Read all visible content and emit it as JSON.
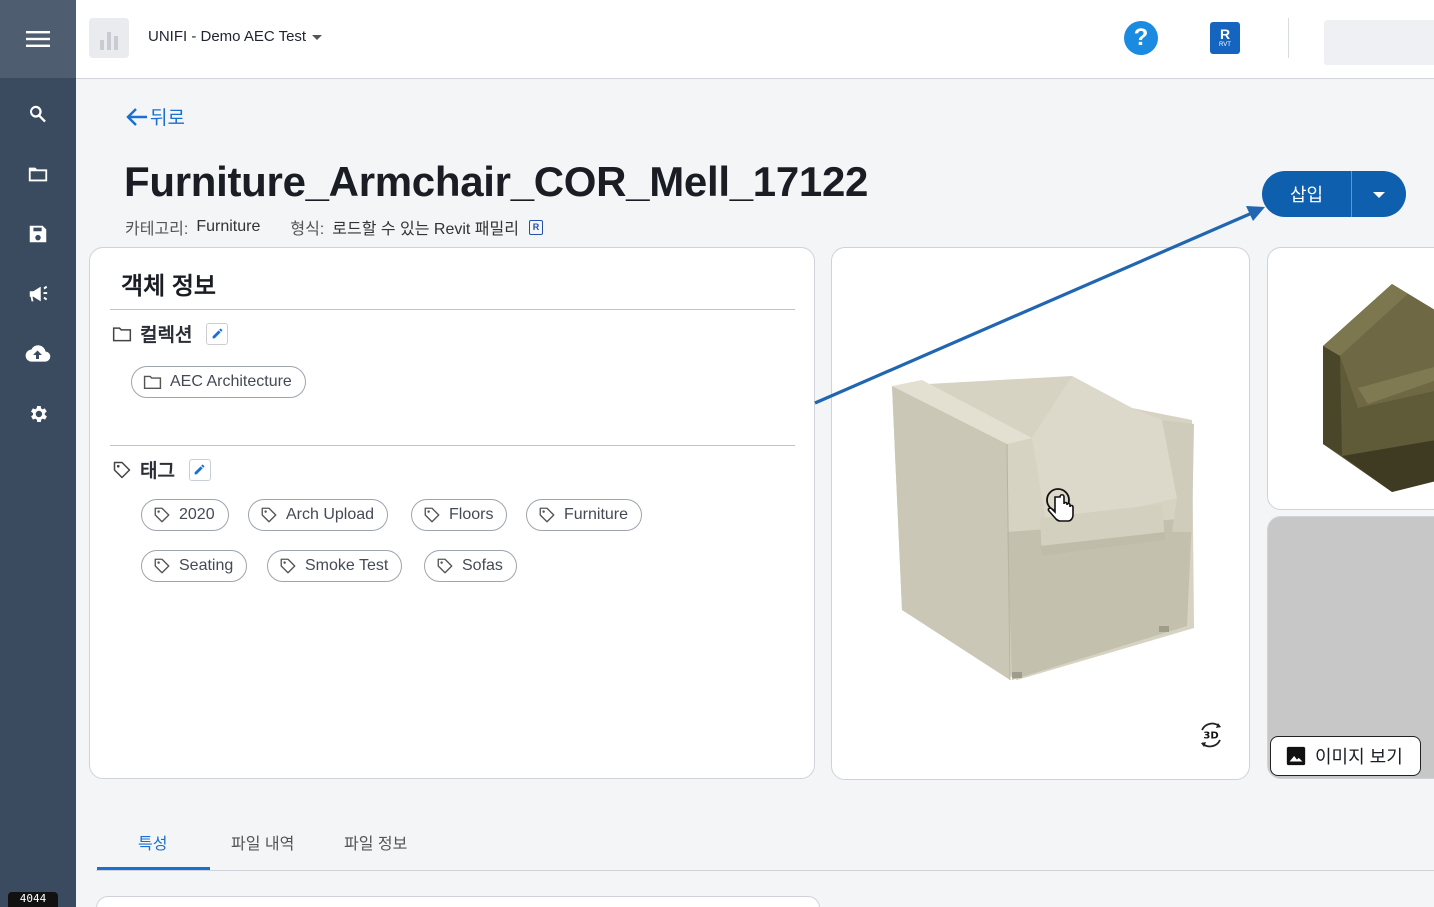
{
  "rail": {
    "items": [
      {
        "name": "search"
      },
      {
        "name": "folder"
      },
      {
        "name": "save"
      },
      {
        "name": "announcement"
      },
      {
        "name": "cloud-upload"
      },
      {
        "name": "settings"
      }
    ],
    "badge": "4044"
  },
  "topbar": {
    "project_name": "UNIFI - Demo AEC Test",
    "help_label": "?",
    "revit_letter": "R",
    "revit_sub": "RVT"
  },
  "header": {
    "back_label": "뒤로",
    "title": "Furniture_Armchair_COR_Mell_17122",
    "category_label": "카테고리:",
    "category_value": "Furniture",
    "format_label": "형식:",
    "format_value": "로드할 수 있는 Revit 패밀리",
    "insert_label": "삽입"
  },
  "info": {
    "title": "객체 정보",
    "collections_label": "컬렉션",
    "collections": [
      "AEC Architecture"
    ],
    "tags_label": "태그",
    "tags": [
      "2020",
      "Arch Upload",
      "Floors",
      "Furniture",
      "Seating",
      "Smoke Test",
      "Sofas"
    ]
  },
  "viewer": {
    "rotate_label": "3D",
    "view_image_label": "이미지 보기"
  },
  "tabs": [
    "특성",
    "파일 내역",
    "파일 정보"
  ],
  "colors": {
    "accent": "#1a6fd1",
    "primary_button": "#0e5fae",
    "rail": "#3a4b60",
    "annotation_arrow": "#2166b0"
  }
}
